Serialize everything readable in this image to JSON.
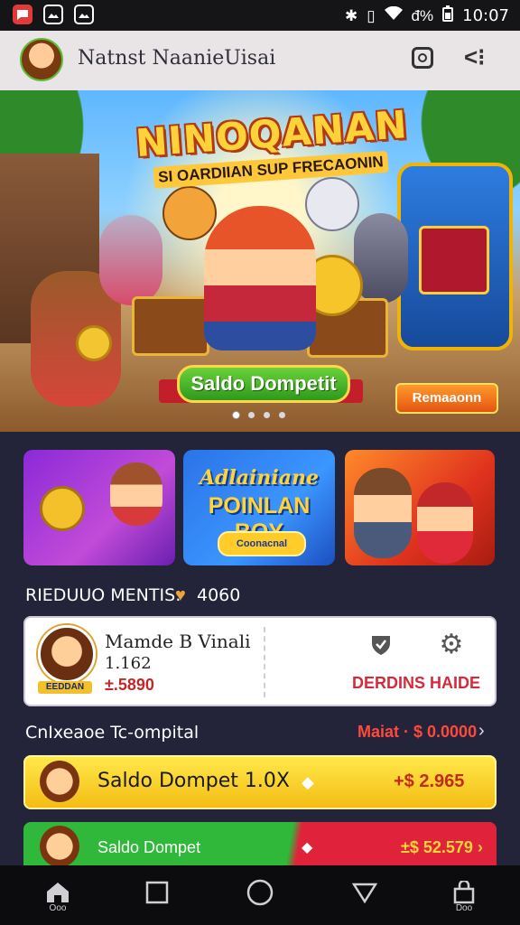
{
  "status_bar": {
    "time": "10:07",
    "battery_text": "đ%"
  },
  "header": {
    "title": "Natnst NaanieUisai"
  },
  "hero": {
    "title": "NINOQANAN",
    "subtitle": "SI OARDIIAN SUP FRECAONIN",
    "button_label": "Saldo Dompetit",
    "badge_label": "Remaaonn",
    "dots": 4,
    "active_dot": 1
  },
  "promo_cards": [
    {
      "name": "coin-card"
    },
    {
      "title": "Adlainiane",
      "subtitle": "POINLAN BOY",
      "button_label": "Coonacnal"
    },
    {
      "name": "friends-card"
    }
  ],
  "section": {
    "label": "RIEDUUO MENTIS:",
    "value": "4060"
  },
  "profile": {
    "name": "Mamde B Vinali",
    "id": "1.162",
    "balance": "±.5890",
    "tag": "EEDDAN",
    "action_label": "DERDINS HAIDE"
  },
  "wallet": {
    "heading": "CnIxeaoe Tc-ompital",
    "more_label": "Maiat · $ 0.0000",
    "rows": [
      {
        "label": "Saldo Dompet  1.0X",
        "amount": "+$ 2.965"
      },
      {
        "label": "Saldo Dompet",
        "amount": "±$ 52.579 ›"
      }
    ]
  },
  "nav": {
    "home_label": "Ooo",
    "bag_label": "Doo"
  },
  "colors": {
    "accent_yellow": "#f4bc14",
    "accent_red": "#d42a3a",
    "accent_green": "#2fb83a",
    "bg_dark": "#23233a"
  }
}
